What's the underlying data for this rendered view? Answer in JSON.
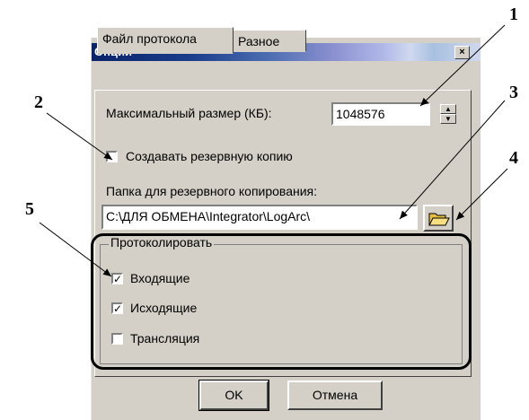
{
  "window": {
    "title": "Опции",
    "close_glyph": "×"
  },
  "tabs": [
    {
      "label": "Файл протокола",
      "active": true
    },
    {
      "label": "Разное",
      "active": false
    }
  ],
  "max_size": {
    "label": "Максимальный размер (КБ):",
    "value": "1048576"
  },
  "backup": {
    "label": "Создавать резервную копию",
    "checked": false
  },
  "backup_folder": {
    "label": "Папка для резервного копирования:",
    "value": "C:\\ДЛЯ ОБМЕНА\\Integrator\\LogArc\\",
    "button_icon": "folder-open-icon"
  },
  "log_group": {
    "legend": "Протоколировать",
    "items": [
      {
        "label": "Входящие",
        "checked": true
      },
      {
        "label": "Исходящие",
        "checked": true
      },
      {
        "label": "Трансляция",
        "checked": false
      }
    ]
  },
  "buttons": {
    "ok": "OK",
    "cancel": "Отмена"
  },
  "callouts": [
    "1",
    "2",
    "3",
    "4",
    "5"
  ],
  "colors": {
    "titlebar_start": "#0a246a",
    "dialog_bg": "#d4d0c8"
  }
}
